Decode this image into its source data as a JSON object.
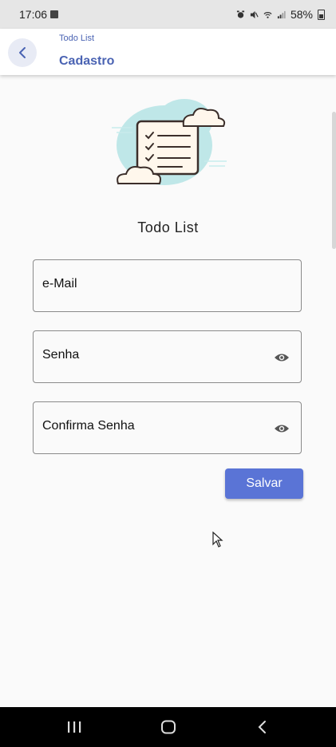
{
  "status_bar": {
    "time": "17:06",
    "battery": "58%"
  },
  "app_bar": {
    "breadcrumb": "Todo List",
    "title": "Cadastro"
  },
  "form": {
    "heading": "Todo List",
    "fields": [
      {
        "label": "e-Mail"
      },
      {
        "label": "Senha"
      },
      {
        "label": "Confirma Senha"
      }
    ],
    "save_label": "Salvar"
  },
  "colors": {
    "primary": "#5a74d6",
    "title_blue": "#4a63b3",
    "background": "#fafafa"
  },
  "icons": [
    "back-arrow-icon",
    "eye-icon",
    "checklist-illustration",
    "recents-icon",
    "home-icon",
    "back-icon"
  ]
}
